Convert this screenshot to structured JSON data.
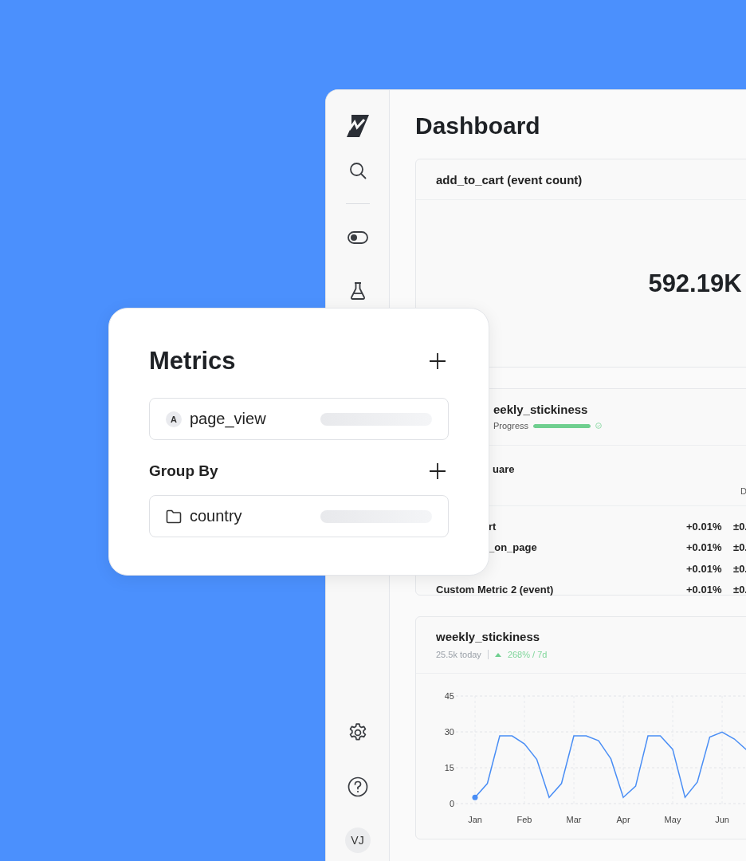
{
  "sidebar": {
    "avatar": "VJ"
  },
  "page": {
    "title": "Dashboard"
  },
  "event_card": {
    "title": "add_to_cart (event count)",
    "value": "592.19K"
  },
  "experiment_card": {
    "title": "eekly_stickiness",
    "status": "Progress",
    "progress": {
      "level": 1
    },
    "metric_group": "uare",
    "column_header": "D",
    "rows": [
      {
        "label": "rt",
        "clipped": true,
        "values": [
          "+0.01%",
          "±0."
        ]
      },
      {
        "label": "_on_page",
        "clipped": true,
        "values": [
          "+0.01%",
          "±0."
        ]
      },
      {
        "values": [
          "+0.01%",
          "±0."
        ]
      },
      {
        "label": "Custom Metric 2 (event)",
        "clipped": false,
        "values": [
          "+0.01%",
          "±0."
        ]
      }
    ]
  },
  "chart_card": {
    "title": "weekly_stickiness",
    "today": "25.5k today",
    "change": "268% / 7d",
    "chart_data": {
      "type": "line",
      "grid": true,
      "ylim": [
        0,
        45
      ],
      "yticks": [
        0,
        15,
        30,
        45
      ],
      "categories": [
        "Jan",
        null,
        null,
        null,
        "Feb",
        null,
        null,
        null,
        "Mar",
        null,
        null,
        null,
        "Apr",
        null,
        null,
        null,
        "May",
        null,
        null,
        null,
        "Jun",
        null,
        null
      ],
      "series": [
        {
          "color": "#4a8ef5",
          "values": [
            2.6,
            8.4,
            28.3,
            28.3,
            25,
            18.5,
            2.6,
            8.4,
            28.3,
            28.3,
            26.3,
            18.7,
            2.6,
            7.3,
            28.3,
            28.3,
            22.7,
            2.6,
            9,
            27.8,
            29.9,
            27,
            22.4
          ]
        }
      ]
    }
  },
  "panel": {
    "sections": [
      {
        "title": "Metrics",
        "item": {
          "kind": "metric",
          "badge": "A",
          "label": "page_view"
        }
      },
      {
        "title": "Group By",
        "item": {
          "kind": "dimension",
          "label": "country"
        }
      }
    ]
  }
}
